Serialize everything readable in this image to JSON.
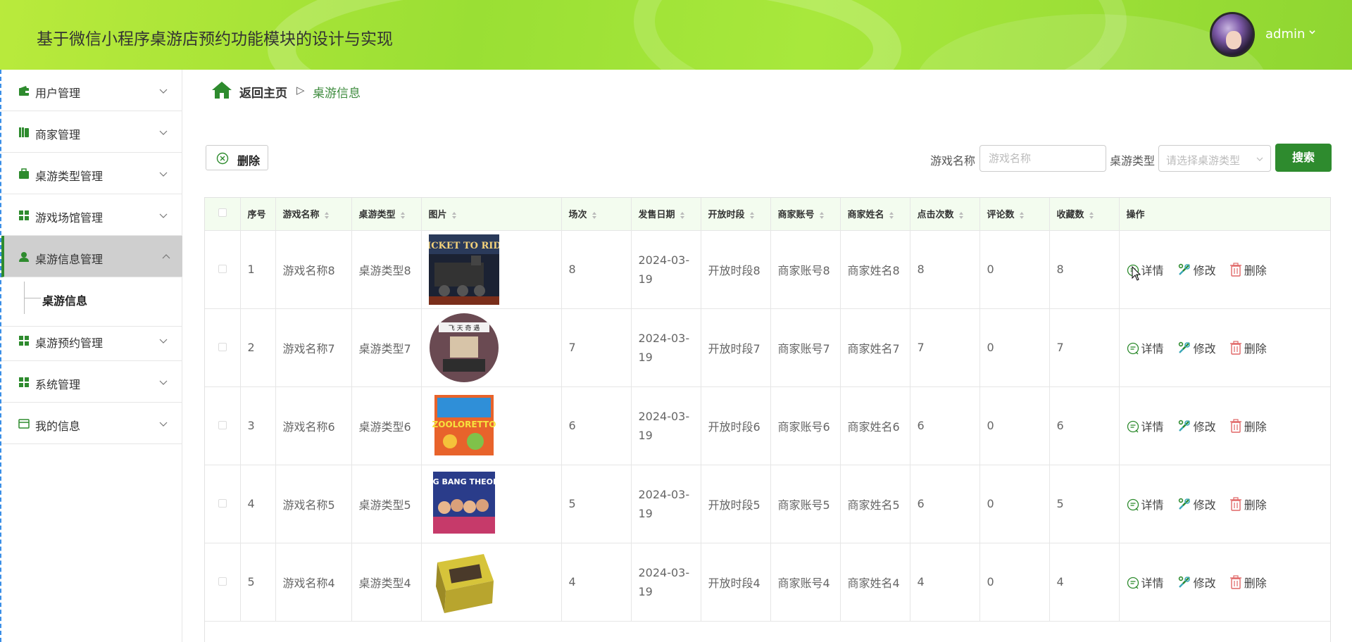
{
  "app": {
    "title": "基于微信小程序桌游店预约功能模块的设计与实现"
  },
  "user": {
    "name": "admin"
  },
  "sidebar": {
    "items": [
      {
        "label": "用户管理",
        "icon": "wallet-icon"
      },
      {
        "label": "商家管理",
        "icon": "books-icon"
      },
      {
        "label": "桌游类型管理",
        "icon": "briefcase-icon"
      },
      {
        "label": "游戏场馆管理",
        "icon": "grid-icon"
      },
      {
        "label": "桌游信息管理",
        "icon": "person-icon",
        "active": true
      },
      {
        "label": "桌游预约管理",
        "icon": "grid-icon"
      },
      {
        "label": "系统管理",
        "icon": "grid-icon"
      },
      {
        "label": "我的信息",
        "icon": "card-icon"
      }
    ],
    "submenu": {
      "label": "桌游信息"
    }
  },
  "breadcrumb": {
    "home": "返回主页",
    "separator": "▷",
    "current": "桌游信息"
  },
  "toolbar": {
    "delete_label": "删除",
    "name_label": "游戏名称",
    "name_placeholder": "游戏名称",
    "type_label": "桌游类型",
    "type_placeholder": "请选择桌游类型",
    "search_label": "搜索"
  },
  "table": {
    "headers": [
      "序号",
      "游戏名称",
      "桌游类型",
      "图片",
      "场次",
      "发售日期",
      "开放时段",
      "商家账号",
      "商家姓名",
      "点击次数",
      "评论数",
      "收藏数",
      "操作"
    ],
    "actions": {
      "detail": "详情",
      "edit": "修改",
      "delete": "删除"
    },
    "rows": [
      {
        "index": "1",
        "name": "游戏名称8",
        "type": "桌游类型8",
        "sessions": "8",
        "date": "2024-03-19",
        "period": "开放时段8",
        "account": "商家账号8",
        "merchant": "商家姓名8",
        "clicks": "8",
        "comments": "0",
        "favorites": "8"
      },
      {
        "index": "2",
        "name": "游戏名称7",
        "type": "桌游类型7",
        "sessions": "7",
        "date": "2024-03-19",
        "period": "开放时段7",
        "account": "商家账号7",
        "merchant": "商家姓名7",
        "clicks": "7",
        "comments": "0",
        "favorites": "7"
      },
      {
        "index": "3",
        "name": "游戏名称6",
        "type": "桌游类型6",
        "sessions": "6",
        "date": "2024-03-19",
        "period": "开放时段6",
        "account": "商家账号6",
        "merchant": "商家姓名6",
        "clicks": "6",
        "comments": "0",
        "favorites": "6"
      },
      {
        "index": "4",
        "name": "游戏名称5",
        "type": "桌游类型5",
        "sessions": "5",
        "date": "2024-03-19",
        "period": "开放时段5",
        "account": "商家账号5",
        "merchant": "商家姓名5",
        "clicks": "6",
        "comments": "0",
        "favorites": "5"
      },
      {
        "index": "5",
        "name": "游戏名称4",
        "type": "桌游类型4",
        "sessions": "4",
        "date": "2024-03-19",
        "period": "开放时段4",
        "account": "商家账号4",
        "merchant": "商家姓名4",
        "clicks": "4",
        "comments": "0",
        "favorites": "4"
      }
    ]
  },
  "colors": {
    "accent": "#2e8b2e",
    "header_green": "#a8e83c",
    "table_header_bg": "#f3fcef",
    "active_menu_bg": "#cfcfcf"
  }
}
